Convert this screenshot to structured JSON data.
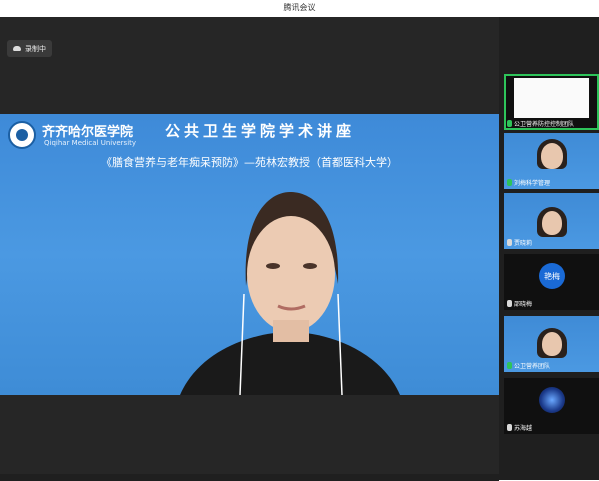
{
  "window": {
    "title": "腾讯会议"
  },
  "recording": {
    "label": "录制中"
  },
  "stage": {
    "university_cn": "齐齐哈尔医学院",
    "university_en": "Qiqihar Medical University",
    "lecture_title": "公共卫生学院学术讲座",
    "subtitle": "《膳食营养与老年痴呆预防》—苑林宏教授（首都医科大学）"
  },
  "participants": [
    {
      "name": "公卫营养防控控制团队",
      "mic": "active"
    },
    {
      "name": "刘梅科学管理",
      "mic": "active"
    },
    {
      "name": "贾晓莉",
      "mic": "muted"
    },
    {
      "name": "邵晓梅",
      "mic": "muted",
      "avatar_text": "艳梅",
      "avatar_color": "#1a6ad6"
    },
    {
      "name": "公卫营养团队",
      "mic": "active"
    },
    {
      "name": "苏海越",
      "mic": "muted"
    }
  ],
  "colors": {
    "accent_green": "#2ec45a",
    "stage_blue": "#4596df"
  }
}
